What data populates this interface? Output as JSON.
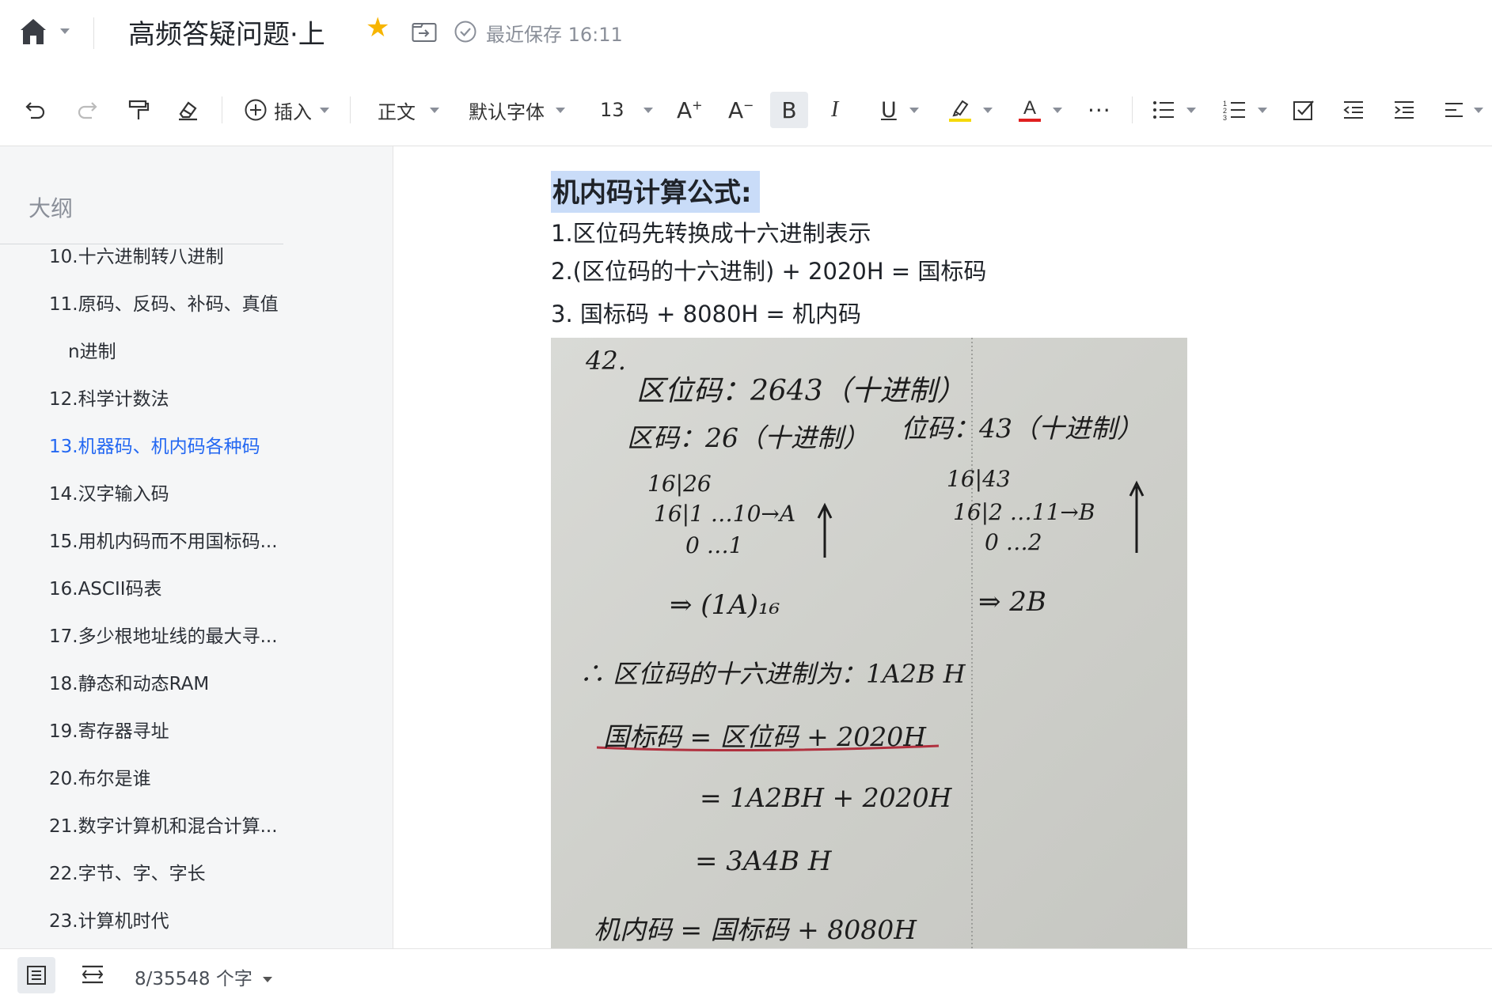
{
  "header": {
    "title": "高频答疑问题·上",
    "save_status": "最近保存 16:11",
    "icons": [
      "home-icon",
      "chevron-down-icon",
      "star-icon",
      "move-to-folder-icon",
      "saved-check-icon"
    ],
    "colors": {
      "star": "#f7b500"
    }
  },
  "toolbar": {
    "insert_label": "插入",
    "style_label": "正文",
    "font_label": "默认字体",
    "size_label": "13",
    "icons": [
      "undo-icon",
      "redo-icon",
      "format-painter-icon",
      "clear-format-icon",
      "insert-icon",
      "increase-font-icon",
      "decrease-font-icon",
      "bold-icon",
      "italic-icon",
      "underline-icon",
      "highlight-icon",
      "font-color-icon",
      "more-icon",
      "bullet-list-icon",
      "numbered-list-icon",
      "checkbox-list-icon",
      "outdent-icon",
      "indent-icon",
      "align-icon"
    ],
    "colors": {
      "highlight": "#f5d90a",
      "font_color": "#e02020"
    }
  },
  "outline": {
    "title": "大纲",
    "items": [
      {
        "label": "10.十六进制转八进制"
      },
      {
        "label": "11.原码、反码、补码、真值"
      },
      {
        "label": "n进制"
      },
      {
        "label": "12.科学计数法"
      },
      {
        "label": "13.机器码、机内码各种码",
        "active": true
      },
      {
        "label": "14.汉字输入码"
      },
      {
        "label": "15.用机内码而不用国标码..."
      },
      {
        "label": "16.ASCII码表"
      },
      {
        "label": "17.多少根地址线的最大寻..."
      },
      {
        "label": "18.静态和动态RAM"
      },
      {
        "label": "19.寄存器寻址"
      },
      {
        "label": "20.布尔是谁"
      },
      {
        "label": "21.数字计算机和混合计算..."
      },
      {
        "label": "22.字节、字、字长"
      },
      {
        "label": "23.计算机时代"
      }
    ],
    "colors": {
      "active": "#2468f2"
    }
  },
  "content": {
    "heading": "机内码计算公式:",
    "line1": "1.区位码先转换成十六进制表示",
    "line2": "2.(区位码的十六进制) + 2020H = 国标码",
    "line3": "3.   国标码 + 8080H = 机内码",
    "photo": {
      "problem_no": "42.",
      "l1": "区位码：2643（十进制）",
      "l2a": "区码：26（十进制）",
      "l2b": "位码：43（十进制）",
      "d1a": "16|26",
      "d1b": "16|1  …10→A",
      "d1c": "0 …1",
      "d2a": "16|43",
      "d2b": "16|2  …11→B",
      "d2c": "0 …2",
      "r1": "⇒ (1A)₁₆",
      "r2": "⇒ 2B",
      "l3": "∴ 区位码的十六进制为：1A2B H",
      "l4": "国标码 = 区位码 + 2020H",
      "l5": "= 1A2BH + 2020H",
      "l6": "= 3A4B H",
      "l7": "机内码 = 国标码 + 8080H"
    }
  },
  "status": {
    "word_count": "8/35548 个字",
    "icons": [
      "outline-toggle-icon",
      "page-width-icon",
      "chevron-down-icon"
    ]
  }
}
